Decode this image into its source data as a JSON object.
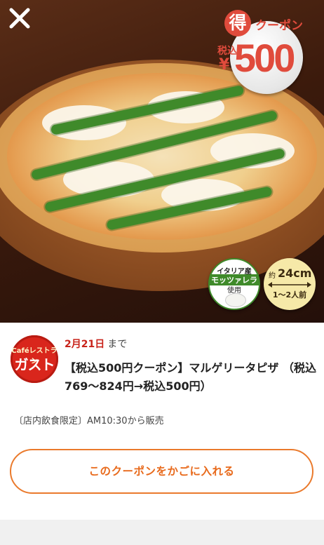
{
  "hero": {
    "coupon_badge": {
      "toku": "得",
      "coupon_word": "クーポン",
      "tax_word": "税込",
      "yen": "¥",
      "price": "500"
    },
    "mozzarella_badge": {
      "line1": "イタリア産",
      "line2": "モッツァレラ",
      "line3": "使用"
    },
    "size_badge": {
      "about": "約",
      "size": "24cm",
      "people": "1〜2人前"
    }
  },
  "close_icon": "close-icon",
  "logo": {
    "cafe": "Caféレストラン",
    "brand": "ガスト",
    "color": "#d9261c"
  },
  "deadline": {
    "date": "2月21日",
    "suffix": "まで"
  },
  "title": "【税込500円クーポン】マルゲリータピザ （税込769〜824円→税込500円）",
  "note": "〔店内飲食限定〕AM10:30から販売",
  "cart_button": "このクーポンをかごに入れる",
  "colors": {
    "accent_orange": "#e86a1c",
    "deadline_red": "#c8231a",
    "coupon_red": "#e04b3c"
  }
}
